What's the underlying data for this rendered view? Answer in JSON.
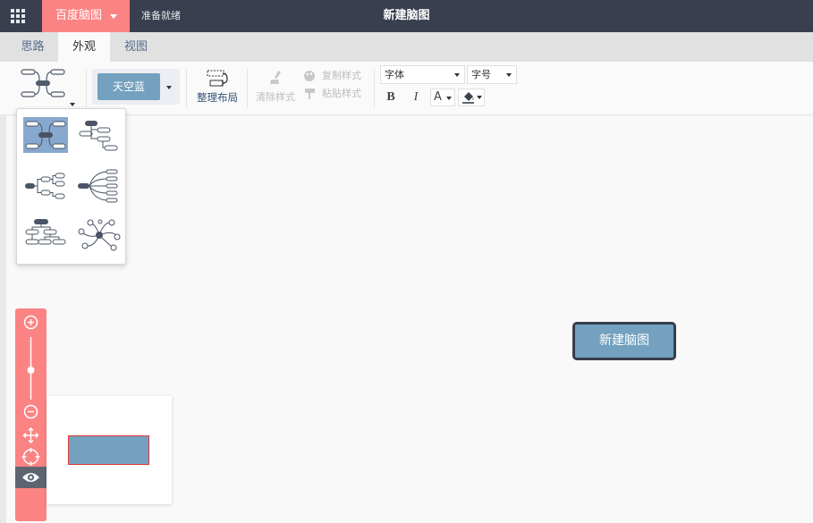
{
  "titlebar": {
    "brand": "百度脑图",
    "status": "准备就绪",
    "title": "新建脑图"
  },
  "tabs": [
    {
      "label": "思路",
      "active": false
    },
    {
      "label": "外观",
      "active": true
    },
    {
      "label": "视图",
      "active": false
    }
  ],
  "toolbar": {
    "theme_label": "天空蓝",
    "arrange_label": "整理布局",
    "clear_style_label": "清除样式",
    "copy_style_label": "复制样式",
    "paste_style_label": "粘贴样式",
    "font_family_placeholder": "字体",
    "font_size_placeholder": "字号",
    "bold_label": "B",
    "italic_label": "I",
    "font_color_label": "A"
  },
  "layout_menu": {
    "options": [
      "mind",
      "right",
      "filetree",
      "fish-bone",
      "tianpan",
      "org"
    ],
    "selected": "mind"
  },
  "canvas": {
    "root_node_text": "新建脑图"
  },
  "colors": {
    "titlebar_bg": "#393f4f",
    "accent": "#fc8383",
    "theme_node": "#73a1bf",
    "node_border": "#363d4c"
  }
}
